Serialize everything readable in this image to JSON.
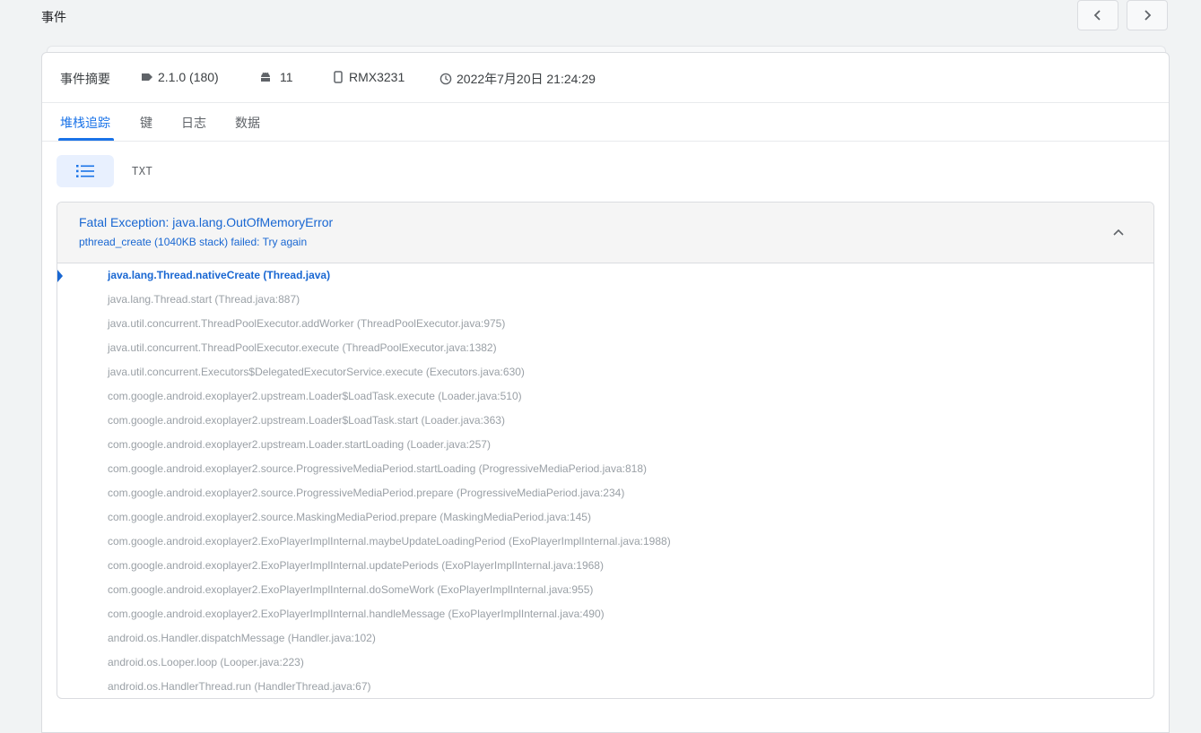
{
  "page": {
    "title": "事件"
  },
  "summary": {
    "label": "事件摘要",
    "version": "2.1.0 (180)",
    "os_version": "11",
    "device": "RMX3231",
    "timestamp": "2022年7月20日 21:24:29"
  },
  "tabs": [
    {
      "label": "堆栈追踪",
      "active": true
    },
    {
      "label": "键",
      "active": false
    },
    {
      "label": "日志",
      "active": false
    },
    {
      "label": "数据",
      "active": false
    }
  ],
  "view": {
    "txt_label": "TXT"
  },
  "exception": {
    "title": "Fatal Exception: java.lang.OutOfMemoryError",
    "message": "pthread_create (1040KB stack) failed: Try again"
  },
  "frames": [
    "java.lang.Thread.nativeCreate (Thread.java)",
    "java.lang.Thread.start (Thread.java:887)",
    "java.util.concurrent.ThreadPoolExecutor.addWorker (ThreadPoolExecutor.java:975)",
    "java.util.concurrent.ThreadPoolExecutor.execute (ThreadPoolExecutor.java:1382)",
    "java.util.concurrent.Executors$DelegatedExecutorService.execute (Executors.java:630)",
    "com.google.android.exoplayer2.upstream.Loader$LoadTask.execute (Loader.java:510)",
    "com.google.android.exoplayer2.upstream.Loader$LoadTask.start (Loader.java:363)",
    "com.google.android.exoplayer2.upstream.Loader.startLoading (Loader.java:257)",
    "com.google.android.exoplayer2.source.ProgressiveMediaPeriod.startLoading (ProgressiveMediaPeriod.java:818)",
    "com.google.android.exoplayer2.source.ProgressiveMediaPeriod.prepare (ProgressiveMediaPeriod.java:234)",
    "com.google.android.exoplayer2.source.MaskingMediaPeriod.prepare (MaskingMediaPeriod.java:145)",
    "com.google.android.exoplayer2.ExoPlayerImplInternal.maybeUpdateLoadingPeriod (ExoPlayerImplInternal.java:1988)",
    "com.google.android.exoplayer2.ExoPlayerImplInternal.updatePeriods (ExoPlayerImplInternal.java:1968)",
    "com.google.android.exoplayer2.ExoPlayerImplInternal.doSomeWork (ExoPlayerImplInternal.java:955)",
    "com.google.android.exoplayer2.ExoPlayerImplInternal.handleMessage (ExoPlayerImplInternal.java:490)",
    "android.os.Handler.dispatchMessage (Handler.java:102)",
    "android.os.Looper.loop (Looper.java:223)",
    "android.os.HandlerThread.run (HandlerThread.java:67)"
  ],
  "icons": {
    "version": "label-icon",
    "os": "android-icon",
    "device": "phone-icon",
    "time": "clock-icon",
    "list_view": "list-icon",
    "collapse": "chevron-up-icon",
    "prev": "chevron-left-icon",
    "next": "chevron-right-icon"
  },
  "colors": {
    "accent": "#1a73e8",
    "link": "#1967d2",
    "muted": "#9aa0a6"
  }
}
